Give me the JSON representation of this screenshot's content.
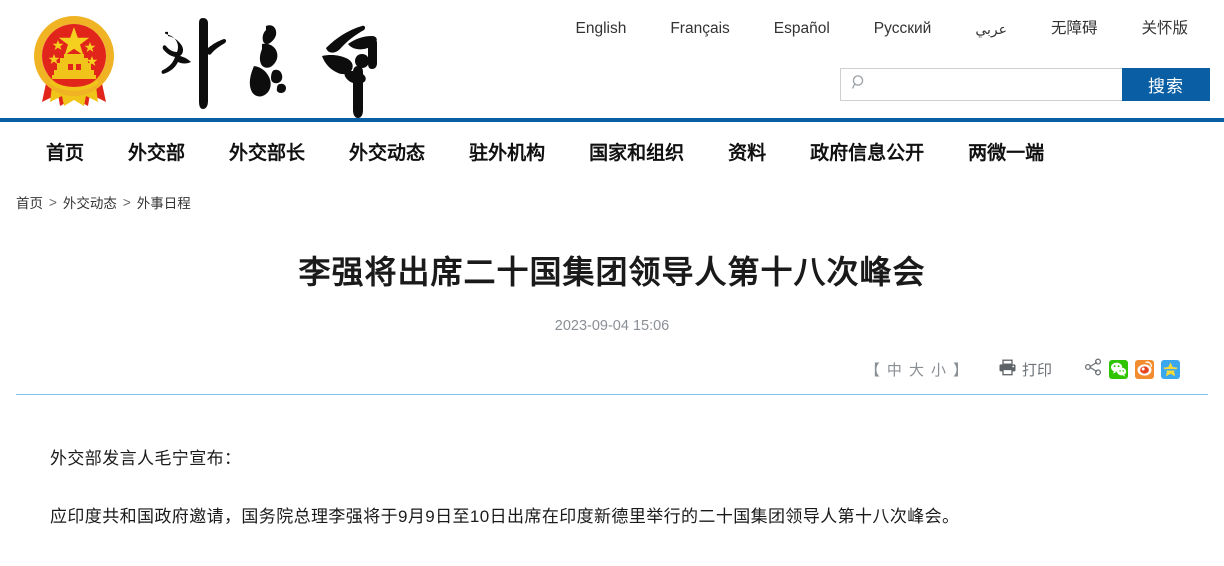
{
  "site": {
    "emblem_alt": "national-emblem-of-china",
    "wordmark": "外交部"
  },
  "lang_bar": {
    "items": [
      {
        "label": "English",
        "name": "lang-english"
      },
      {
        "label": "Français",
        "name": "lang-francais"
      },
      {
        "label": "Español",
        "name": "lang-espanol"
      },
      {
        "label": "Русский",
        "name": "lang-russkiy"
      },
      {
        "label": "عربي",
        "name": "lang-arabic"
      },
      {
        "label": "无障碍",
        "name": "accessibility-mode"
      },
      {
        "label": "关怀版",
        "name": "care-version"
      }
    ]
  },
  "search": {
    "value": "",
    "placeholder": "",
    "button_label": "搜索",
    "icon": "search-icon",
    "button_color": "#0a5fa4"
  },
  "nav": {
    "accent_color": "#0a5fa4",
    "items": [
      {
        "label": "首页",
        "name": "nav-item-home"
      },
      {
        "label": "外交部",
        "name": "nav-item-ministry"
      },
      {
        "label": "外交部长",
        "name": "nav-item-minister"
      },
      {
        "label": "外交动态",
        "name": "nav-item-news"
      },
      {
        "label": "驻外机构",
        "name": "nav-item-missions"
      },
      {
        "label": "国家和组织",
        "name": "nav-item-countries"
      },
      {
        "label": "资料",
        "name": "nav-item-resources"
      },
      {
        "label": "政府信息公开",
        "name": "nav-item-disclosure"
      },
      {
        "label": "两微一端",
        "name": "nav-item-social"
      }
    ]
  },
  "breadcrumb": {
    "items": [
      "首页",
      "外交动态",
      "外事日程"
    ],
    "separator": ">"
  },
  "article": {
    "headline": "李强将出席二十国集团领导人第十八次峰会",
    "pubtime": "2023-09-04 15:06",
    "paragraphs": [
      "外交部发言人毛宁宣布：",
      "应印度共和国政府邀请，国务院总理李强将于9月9日至10日出席在印度新德里举行的二十国集团领导人第十八次峰会。"
    ]
  },
  "toolbar": {
    "fontsize": {
      "bracket_left": "【",
      "medium": "中",
      "large": "大",
      "small": "小",
      "bracket_right": "】"
    },
    "print_label": "打印",
    "print_icon": "printer-icon",
    "share_icon": "share-nodes-icon",
    "share_targets": [
      {
        "name": "share-wechat",
        "label": "微信",
        "color": "#2ec500"
      },
      {
        "name": "share-weibo",
        "label": "新浪微博",
        "color": "#f28c2e"
      },
      {
        "name": "share-qzone",
        "label": "QQ空间",
        "color": "#3aa7ef"
      }
    ]
  }
}
